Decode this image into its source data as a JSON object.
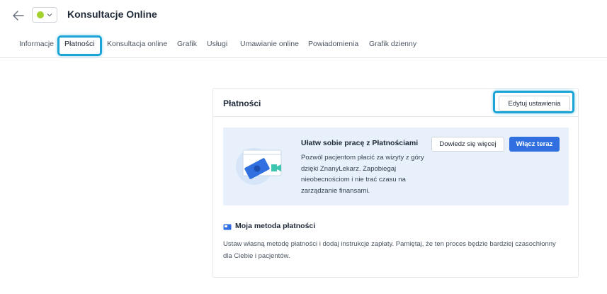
{
  "header": {
    "title": "Konsultacje Online",
    "status_color": "#a3d12e"
  },
  "tabs": [
    {
      "label": "Informacje"
    },
    {
      "label": "Płatności",
      "active": true
    },
    {
      "label": "Konsultacja online"
    },
    {
      "label": "Grafik"
    },
    {
      "label": "Usługi"
    },
    {
      "label": "Umawianie online"
    },
    {
      "label": "Powiadomienia"
    },
    {
      "label": "Grafik dzienny"
    }
  ],
  "card": {
    "title": "Płatności",
    "edit_button": "Edytuj ustawienia",
    "promo": {
      "title": "Ułatw sobie pracę z Płatnościami",
      "text": "Pozwól pacjentom płacić za wizyty z góry dzięki ZnanyLekarz. Zapobiegaj nieobecnościom i nie trać czasu na zarządzanie finansami.",
      "learn_more_button": "Dowiedz się więcej",
      "enable_button": "Włącz teraz"
    },
    "method": {
      "title": "Moja metoda płatności",
      "text": "Ustaw własną metodę płatności i dodaj instrukcje zapłaty. Pamiętaj, że ten proces będzie bardziej czasochłonny dla Ciebie i pacjentów."
    }
  },
  "colors": {
    "accent": "#2f6fe0",
    "highlight": "#1aa5d6",
    "promo_bg": "#e8f1fb"
  }
}
